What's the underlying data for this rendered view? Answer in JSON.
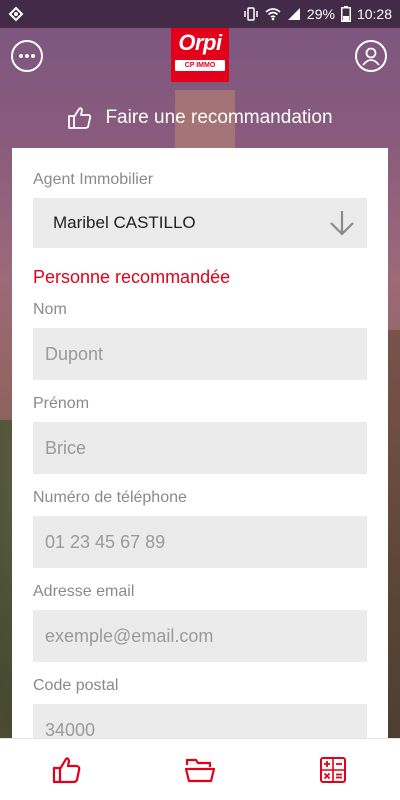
{
  "status_bar": {
    "battery": "29%",
    "time": "10:28"
  },
  "header": {
    "logo_text": "Orpi",
    "logo_subtitle": "CP IMMO",
    "title": "Faire une recommandation"
  },
  "form": {
    "agent_label": "Agent Immobilier",
    "agent_value": "Maribel CASTILLO",
    "section_title": "Personne recommandée",
    "fields": [
      {
        "label": "Nom",
        "placeholder": "Dupont"
      },
      {
        "label": "Prénom",
        "placeholder": "Brice"
      },
      {
        "label": "Numéro de téléphone",
        "placeholder": "01 23 45 67 89"
      },
      {
        "label": "Adresse email",
        "placeholder": "exemple@email.com"
      },
      {
        "label": "Code postal",
        "placeholder": "34000"
      }
    ]
  },
  "icons": {
    "menu": "more-icon",
    "profile": "user-icon",
    "title": "thumbs-up-icon",
    "select": "arrow-down-icon",
    "tabs": [
      "thumbs-up-icon",
      "folder-icon",
      "calculator-icon"
    ]
  },
  "colors": {
    "brand": "#e2001a",
    "field_bg": "#ebebeb",
    "label": "#8a8a8a"
  }
}
